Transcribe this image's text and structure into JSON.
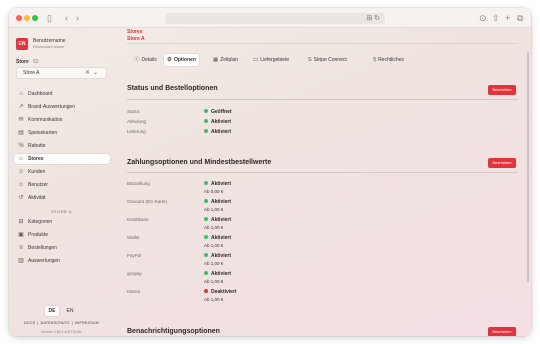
{
  "colors": {
    "accent": "#e3333d",
    "status_green": "#3dbf6f",
    "status_red": "#e3333d"
  },
  "toolbar": {
    "back_icon": "chevron-left-icon",
    "forward_icon": "chevron-right-icon",
    "sidebar_toggle_icon": "sidebar-icon"
  },
  "brand": {
    "logo": "EN",
    "name": "Benutzername",
    "sub": "Restaurant Name"
  },
  "store_picker": {
    "label": "Store",
    "count": "83",
    "value": "Store A",
    "clear": "✕",
    "chevron": "⌄"
  },
  "nav": [
    {
      "icon": "⌂",
      "label": "Dashboard"
    },
    {
      "icon": "↗",
      "label": "Brand-Auswertungen"
    },
    {
      "icon": "✉",
      "label": "Kommunikation"
    },
    {
      "icon": "▤",
      "label": "Speisekarten"
    },
    {
      "icon": "%",
      "label": "Rabatte"
    },
    {
      "icon": "⌂",
      "label": "Stores"
    },
    {
      "icon": "☺",
      "label": "Kunden"
    },
    {
      "icon": "☺",
      "label": "Benutzer"
    },
    {
      "icon": "↺",
      "label": "Aktivität"
    }
  ],
  "store_section_label": "STORE A",
  "store_nav": [
    {
      "icon": "⊟",
      "label": "Kategorien"
    },
    {
      "icon": "▣",
      "label": "Produkte"
    },
    {
      "icon": "≡",
      "label": "Bestellungen"
    },
    {
      "icon": "▥",
      "label": "Auswertungen"
    }
  ],
  "languages": [
    "DE",
    "EN"
  ],
  "footer": {
    "links": [
      "DOCS",
      "DATENSCHUTZ",
      "IMPRESSUM"
    ],
    "version": "Version 4.54.1 #0377b48c"
  },
  "breadcrumb": {
    "parent": "Stores",
    "current": "Store A"
  },
  "tabs": [
    {
      "icon": "ⓘ",
      "label": "Details"
    },
    {
      "icon": "⚙",
      "label": "Optionen"
    },
    {
      "icon": "▦",
      "label": "Zeitplan"
    },
    {
      "icon": "▭",
      "label": "Liefergebiete"
    },
    {
      "icon": "S",
      "label": "Stripe Connect"
    },
    {
      "icon": "§",
      "label": "Rechtliches"
    }
  ],
  "sections": {
    "status": {
      "title": "Status und Bestelloptionen",
      "edit": "Bearbeiten",
      "rows": [
        {
          "label": "Status",
          "value": "Geöffnet",
          "status": "green"
        },
        {
          "label": "Abholung",
          "value": "Aktiviert",
          "status": "green"
        },
        {
          "label": "Lieferung",
          "value": "Aktiviert",
          "status": "green"
        }
      ]
    },
    "payment": {
      "title": "Zahlungsoptionen und Mindestbestellwerte",
      "edit": "Bearbeiten",
      "rows": [
        {
          "label": "Barzahlung",
          "value": "Aktiviert",
          "status": "green",
          "min": "Ab 0,00 €"
        },
        {
          "label": "Girocard (EC-Karte)",
          "value": "Aktiviert",
          "status": "green",
          "min": "Ab 1,00 €"
        },
        {
          "label": "Kreditkarte",
          "value": "Aktiviert",
          "status": "green",
          "min": "Ab 1,00 €"
        },
        {
          "label": "Wallet",
          "value": "Aktiviert",
          "status": "green",
          "min": "Ab 1,00 €"
        },
        {
          "label": "PayPal",
          "value": "Aktiviert",
          "status": "green",
          "min": "Ab 1,00 €"
        },
        {
          "label": "giropay",
          "value": "Aktiviert",
          "status": "green",
          "min": "Ab 1,00 €"
        },
        {
          "label": "Klarna",
          "value": "Deaktiviert",
          "status": "red",
          "min": "Ab 1,00 €"
        }
      ]
    },
    "notifications": {
      "title": "Benachrichtigungsoptionen",
      "edit": "Bearbeiten"
    }
  }
}
